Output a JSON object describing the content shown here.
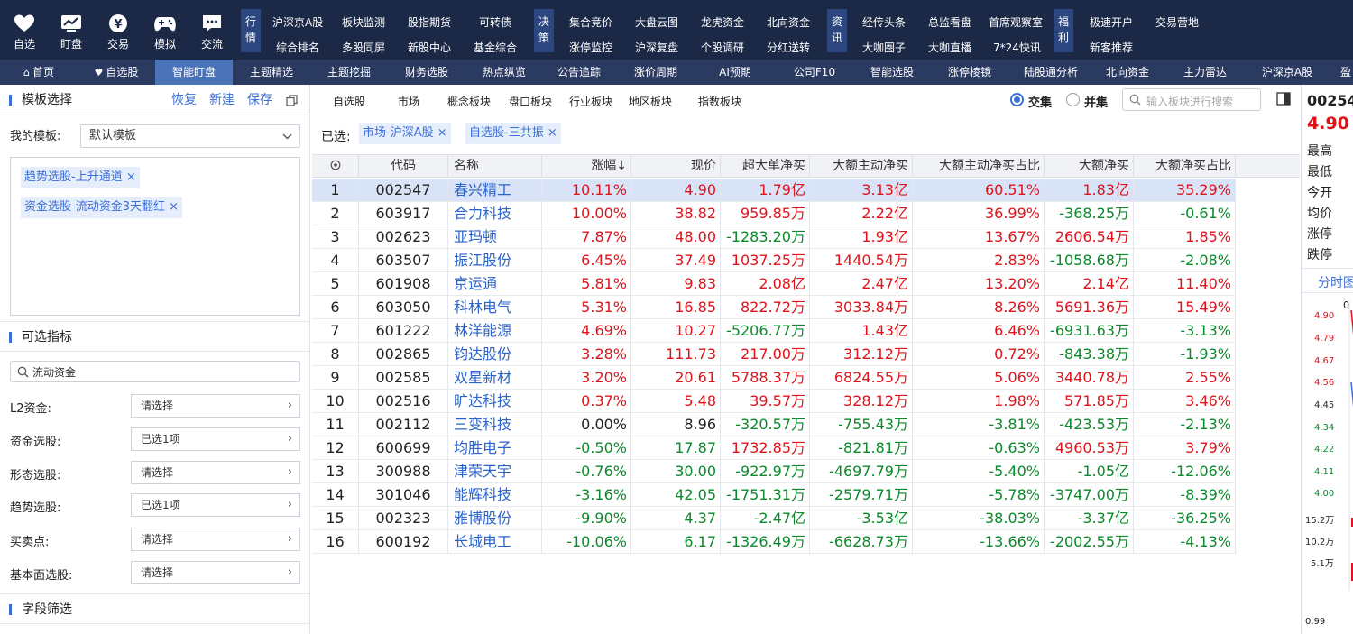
{
  "topnav": {
    "main": [
      {
        "label": "自选",
        "icon": "heart-icon"
      },
      {
        "label": "盯盘",
        "icon": "monitor-chart-icon"
      },
      {
        "label": "交易",
        "icon": "yen-icon"
      },
      {
        "label": "模拟",
        "icon": "gamepad-icon"
      },
      {
        "label": "交流",
        "icon": "chat-icon"
      }
    ],
    "groups": [
      {
        "label": "行情",
        "items": [
          "沪深京A股",
          "板块监测",
          "股指期货",
          "可转债",
          "综合排名",
          "多股同屏",
          "新股中心",
          "基金综合"
        ]
      },
      {
        "label": "决策",
        "items": [
          "集合竞价",
          "大盘云图",
          "龙虎资金",
          "北向资金",
          "涨停监控",
          "沪深复盘",
          "个股调研",
          "分红送转"
        ]
      },
      {
        "label": "资讯",
        "items": [
          "经传头条",
          "总监看盘",
          "首席观察室",
          "大咖圈子",
          "大咖直播",
          "7*24快讯"
        ]
      },
      {
        "label": "福利",
        "items": [
          "极速开户",
          "交易营地",
          "新客推荐"
        ]
      }
    ]
  },
  "tabs": [
    "首页",
    "自选股",
    "智能盯盘",
    "主题精选",
    "主题挖掘",
    "财务选股",
    "热点纵览",
    "公告追踪",
    "涨价周期",
    "AI预期",
    "公司F10",
    "智能选股",
    "涨停棱镜",
    "陆股通分析",
    "北向资金",
    "主力雷达",
    "沪深京A股",
    "盈"
  ],
  "active_tab": "智能盯盘",
  "left": {
    "template_title": "模板选择",
    "actions": [
      "恢复",
      "新建",
      "保存"
    ],
    "my_template_label": "我的模板:",
    "my_template_value": "默认模板",
    "tags": [
      "趋势选股-上升通道",
      "资金选股-流动资金3天翻红"
    ],
    "indicator_title": "可选指标",
    "search_value": "流动资金",
    "filters": [
      {
        "label": "L2资金:",
        "value": "请选择"
      },
      {
        "label": "资金选股:",
        "value": "已选1项"
      },
      {
        "label": "形态选股:",
        "value": "请选择"
      },
      {
        "label": "趋势选股:",
        "value": "已选1项"
      },
      {
        "label": "买卖点:",
        "value": "请选择"
      },
      {
        "label": "基本面选股:",
        "value": "请选择"
      }
    ],
    "field_title": "字段筛选"
  },
  "center": {
    "subtabs": [
      "自选股",
      "市场",
      "概念板块",
      "盘口板块",
      "行业板块",
      "地区板块",
      "指数板块"
    ],
    "radio_intersect": "交集",
    "radio_union": "并集",
    "search_placeholder": "输入板块进行搜索",
    "selected_label": "已选:",
    "selected_tags": [
      "市场-沪深A股",
      "自选股-三共振"
    ],
    "columns": [
      "",
      "代码",
      "名称",
      "涨幅↓",
      "现价",
      "超大单净买",
      "大额主动净买",
      "大额主动净买占比",
      "大额净买",
      "大额净买占比"
    ],
    "rows": [
      [
        "1",
        "002547",
        "春兴精工",
        "10.11%",
        "4.90",
        "1.79亿",
        "3.13亿",
        "60.51%",
        "1.83亿",
        "35.29%"
      ],
      [
        "2",
        "603917",
        "合力科技",
        "10.00%",
        "38.82",
        "959.85万",
        "2.22亿",
        "36.99%",
        "-368.25万",
        "-0.61%"
      ],
      [
        "3",
        "002623",
        "亚玛顿",
        "7.87%",
        "48.00",
        "-1283.20万",
        "1.93亿",
        "13.67%",
        "2606.54万",
        "1.85%"
      ],
      [
        "4",
        "603507",
        "振江股份",
        "6.45%",
        "37.49",
        "1037.25万",
        "1440.54万",
        "2.83%",
        "-1058.68万",
        "-2.08%"
      ],
      [
        "5",
        "601908",
        "京运通",
        "5.81%",
        "9.83",
        "2.08亿",
        "2.47亿",
        "13.20%",
        "2.14亿",
        "11.40%"
      ],
      [
        "6",
        "603050",
        "科林电气",
        "5.31%",
        "16.85",
        "822.72万",
        "3033.84万",
        "8.26%",
        "5691.36万",
        "15.49%"
      ],
      [
        "7",
        "601222",
        "林洋能源",
        "4.69%",
        "10.27",
        "-5206.77万",
        "1.43亿",
        "6.46%",
        "-6931.63万",
        "-3.13%"
      ],
      [
        "8",
        "002865",
        "钧达股份",
        "3.28%",
        "111.73",
        "217.00万",
        "312.12万",
        "0.72%",
        "-843.38万",
        "-1.93%"
      ],
      [
        "9",
        "002585",
        "双星新材",
        "3.20%",
        "20.61",
        "5788.37万",
        "6824.55万",
        "5.06%",
        "3440.78万",
        "2.55%"
      ],
      [
        "10",
        "002516",
        "旷达科技",
        "0.37%",
        "5.48",
        "39.57万",
        "328.12万",
        "1.98%",
        "571.85万",
        "3.46%"
      ],
      [
        "11",
        "002112",
        "三变科技",
        "0.00%",
        "8.96",
        "-320.57万",
        "-755.43万",
        "-3.81%",
        "-423.53万",
        "-2.13%"
      ],
      [
        "12",
        "600699",
        "均胜电子",
        "-0.50%",
        "17.87",
        "1732.85万",
        "-821.81万",
        "-0.63%",
        "4960.53万",
        "3.79%"
      ],
      [
        "13",
        "300988",
        "津荣天宇",
        "-0.76%",
        "30.00",
        "-922.97万",
        "-4697.79万",
        "-5.40%",
        "-1.05亿",
        "-12.06%"
      ],
      [
        "14",
        "301046",
        "能辉科技",
        "-3.16%",
        "42.05",
        "-1751.31万",
        "-2579.71万",
        "-5.78%",
        "-3747.00万",
        "-8.39%"
      ],
      [
        "15",
        "002323",
        "雅博股份",
        "-9.90%",
        "4.37",
        "-2.47亿",
        "-3.53亿",
        "-38.03%",
        "-3.37亿",
        "-36.25%"
      ],
      [
        "16",
        "600192",
        "长城电工",
        "-10.06%",
        "6.17",
        "-1326.49万",
        "-6628.73万",
        "-13.66%",
        "-2002.55万",
        "-4.13%"
      ]
    ]
  },
  "quote": {
    "code": "00254",
    "price": "4.90",
    "labels": [
      "最高",
      "最低",
      "今开",
      "均价",
      "涨停",
      "跌停"
    ],
    "tab": "分时图",
    "axis_top": "0",
    "price_axis": [
      "4.90",
      "4.79",
      "4.67",
      "4.56",
      "4.45",
      "4.34",
      "4.22",
      "4.11",
      "4.00"
    ],
    "volume_axis": [
      "15.2万",
      "10.2万",
      "5.1万"
    ],
    "bottom_axis": "0.99"
  },
  "colors": {
    "up": "#e0121a",
    "down": "#0a8a2a",
    "accent": "#3b6fd6",
    "topbar": "#1b2947",
    "tabbar": "#2a3a61"
  }
}
